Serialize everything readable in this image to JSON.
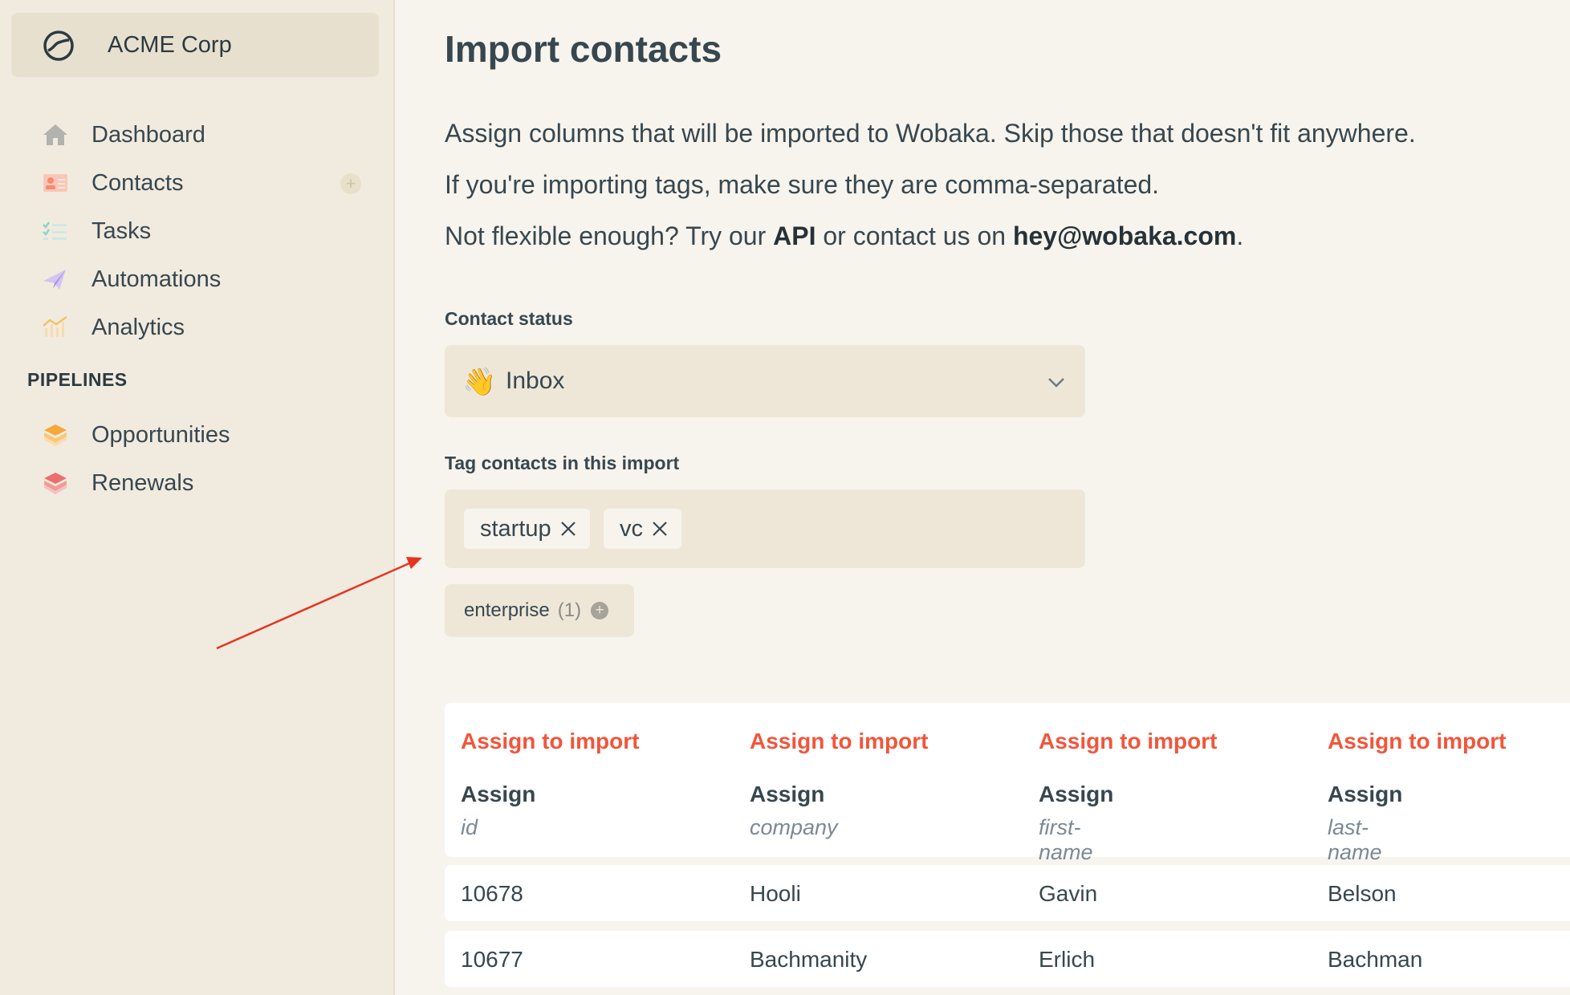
{
  "org": {
    "name": "ACME Corp"
  },
  "nav": {
    "items": [
      {
        "label": "Dashboard"
      },
      {
        "label": "Contacts",
        "add": "+"
      },
      {
        "label": "Tasks"
      },
      {
        "label": "Automations"
      },
      {
        "label": "Analytics"
      }
    ],
    "section": "PIPELINES",
    "pipelines": [
      {
        "label": "Opportunities"
      },
      {
        "label": "Renewals"
      }
    ]
  },
  "page": {
    "title": "Import contacts",
    "line1": "Assign columns that will be imported to Wobaka. Skip those that doesn't fit anywhere.",
    "line2": "If you're importing tags, make sure they are comma-separated.",
    "line3_pre": "Not flexible enough? Try our ",
    "line3_api": "API",
    "line3_mid": " or contact us on ",
    "line3_email": "hey@wobaka.com",
    "line3_post": "."
  },
  "status": {
    "label": "Contact status",
    "emoji": "👋",
    "value": "Inbox"
  },
  "tags": {
    "label": "Tag contacts in this import",
    "chips": [
      "startup",
      "vc"
    ],
    "suggestion": {
      "name": "enterprise",
      "count": "(1)",
      "add": "+"
    }
  },
  "table": {
    "columns": [
      {
        "action": "Assign to import",
        "assign": "Assign",
        "name": "id"
      },
      {
        "action": "Assign to import",
        "assign": "Assign",
        "name": "company"
      },
      {
        "action": "Assign to import",
        "assign": "Assign",
        "name": "first-name"
      },
      {
        "action": "Assign to import",
        "assign": "Assign",
        "name": "last-name"
      }
    ],
    "rows": [
      [
        "10678",
        "Hooli",
        "Gavin",
        "Belson"
      ],
      [
        "10677",
        "Bachmanity",
        "Erlich",
        "Bachman"
      ]
    ]
  },
  "colors": {
    "accent": "#f2553b",
    "annotation_arrow": "#e8321f"
  }
}
